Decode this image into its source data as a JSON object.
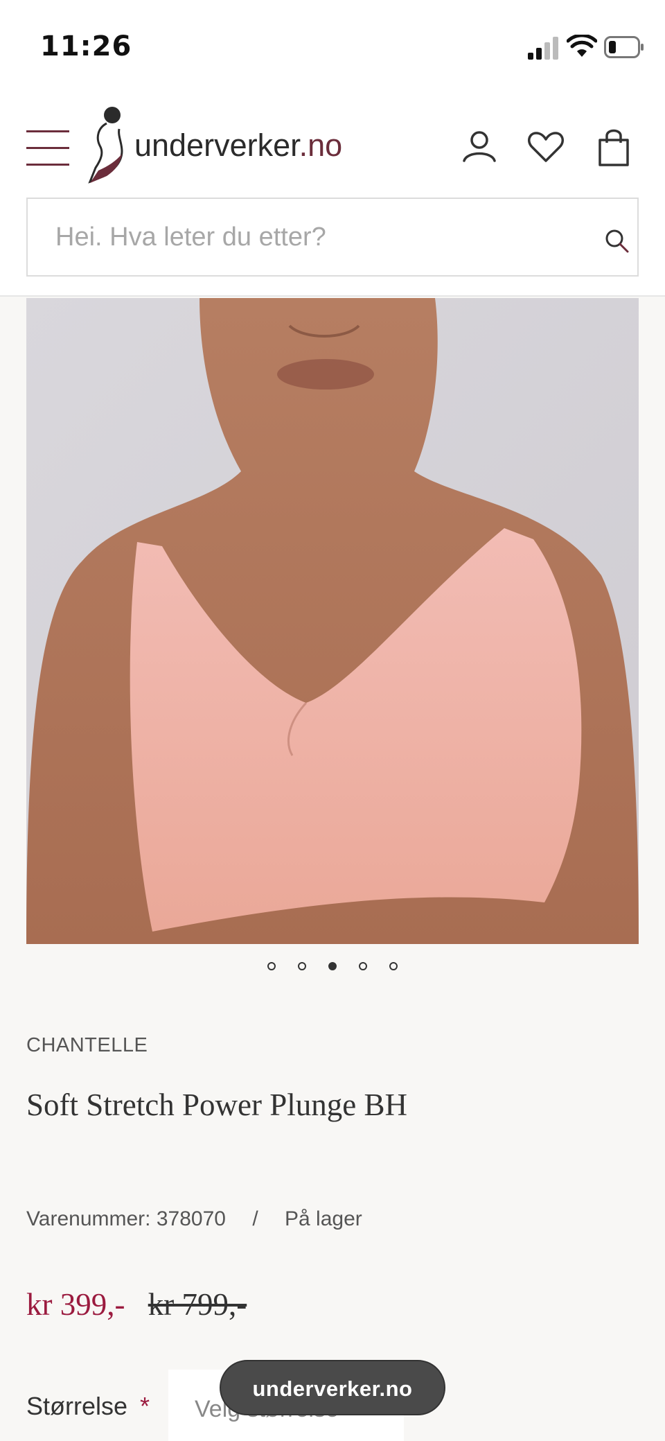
{
  "status_bar": {
    "time": "11:26"
  },
  "header": {
    "logo_text": "underverker",
    "logo_tld": ".no",
    "search_placeholder": "Hei. Hva leter du etter?"
  },
  "gallery": {
    "image_count": 5,
    "active_index": 2
  },
  "product": {
    "brand": "CHANTELLE",
    "title": "Soft Stretch Power Plunge BH",
    "sku_label": "Varenummer:",
    "sku": "378070",
    "separator": "/",
    "stock": "På lager",
    "price_sale": "kr 399,-",
    "price_original": "kr 799,-",
    "size_label": "Størrelse",
    "size_required": "*",
    "size_placeholder": "Velg størrelse"
  },
  "toast": {
    "text": "underverker.no"
  },
  "colors": {
    "brand_accent": "#6b2d3b",
    "sale_price": "#9b1b3f",
    "toast_bg": "#4a4a4a"
  }
}
